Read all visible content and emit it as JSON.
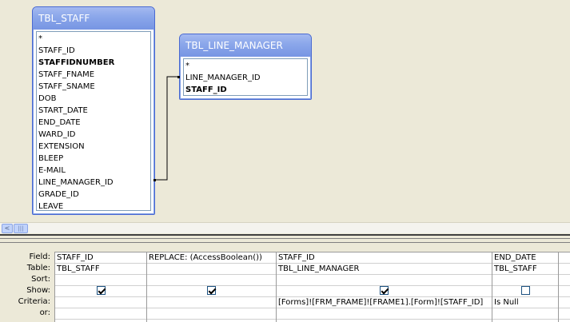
{
  "tables": {
    "staff": {
      "title": "TBL_STAFF",
      "fields": [
        "*",
        "STAFF_ID",
        "STAFFIDNUMBER",
        "STAFF_FNAME",
        "STAFF_SNAME",
        "DOB",
        "START_DATE",
        "END_DATE",
        "WARD_ID",
        "EXTENSION",
        "BLEEP",
        "E-MAIL",
        "LINE_MANAGER_ID",
        "GRADE_ID",
        "LEAVE"
      ]
    },
    "line_manager": {
      "title": "TBL_LINE_MANAGER",
      "fields": [
        "*",
        "LINE_MANAGER_ID",
        "STAFF_ID"
      ]
    }
  },
  "grid": {
    "row_labels": [
      "Field:",
      "Table:",
      "Sort:",
      "Show:",
      "Criteria:",
      "or:"
    ],
    "columns": [
      {
        "field": "STAFF_ID",
        "table": "TBL_STAFF",
        "sort": "",
        "show": true,
        "criteria": "",
        "or": ""
      },
      {
        "field": "REPLACE: (AccessBoolean())",
        "table": "",
        "sort": "",
        "show": true,
        "criteria": "",
        "or": ""
      },
      {
        "field": "STAFF_ID",
        "table": "TBL_LINE_MANAGER",
        "sort": "",
        "show": true,
        "criteria": "[Forms]![FRM_FRAME]![FRAME1].[Form]![STAFF_ID]",
        "or": ""
      },
      {
        "field": "END_DATE",
        "table": "TBL_STAFF",
        "sort": "",
        "show": false,
        "criteria": "Is Null",
        "or": ""
      },
      {
        "field": "",
        "table": "",
        "sort": "",
        "show": null,
        "criteria": "",
        "or": ""
      }
    ]
  },
  "scrollbar": {
    "left_arrow": "<",
    "thumb_grip": "|||"
  }
}
